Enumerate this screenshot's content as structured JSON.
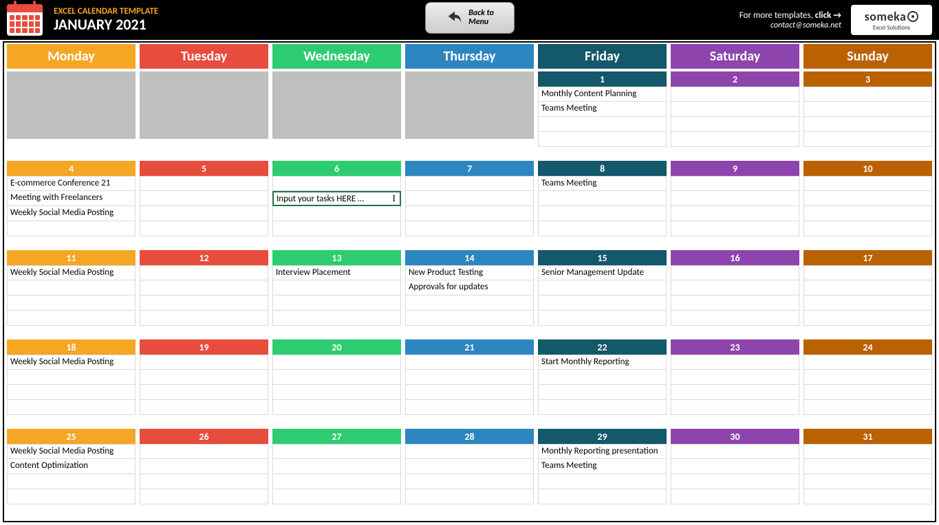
{
  "header": {
    "template_title": "EXCEL CALENDAR TEMPLATE",
    "month": "JANUARY 2021",
    "back_button": "Back to\nMenu",
    "more_templates_prefix": "For more templates, ",
    "more_templates_bold": "click →",
    "contact": "contact@someka.net",
    "logo_name": "someka",
    "logo_sub": "Excel Solutions"
  },
  "days": [
    "Monday",
    "Tuesday",
    "Wednesday",
    "Thursday",
    "Friday",
    "Saturday",
    "Sunday"
  ],
  "day_colors": [
    "#f5a623",
    "#e84c3d",
    "#2ecc71",
    "#2e86c1",
    "#13586b",
    "#8e44ad",
    "#ba6102"
  ],
  "editing_placeholder": "Input your tasks HERE …",
  "weeks": [
    [
      {
        "date": null,
        "tasks": []
      },
      {
        "date": null,
        "tasks": []
      },
      {
        "date": null,
        "tasks": []
      },
      {
        "date": null,
        "tasks": []
      },
      {
        "date": "1",
        "tasks": [
          "Monthly Content Planning",
          "Teams Meeting",
          "",
          ""
        ]
      },
      {
        "date": "2",
        "tasks": [
          "",
          "",
          "",
          ""
        ]
      },
      {
        "date": "3",
        "tasks": [
          "",
          "",
          "",
          ""
        ]
      }
    ],
    [
      {
        "date": "4",
        "tasks": [
          "E-commerce Conference 21",
          "Meeting with Freelancers",
          "Weekly Social Media Posting",
          ""
        ]
      },
      {
        "date": "5",
        "tasks": [
          "",
          "",
          "",
          ""
        ]
      },
      {
        "date": "6",
        "tasks": [
          "",
          "",
          "",
          ""
        ],
        "editing": true
      },
      {
        "date": "7",
        "tasks": [
          "",
          "",
          "",
          ""
        ]
      },
      {
        "date": "8",
        "tasks": [
          "Teams Meeting",
          "",
          "",
          ""
        ]
      },
      {
        "date": "9",
        "tasks": [
          "",
          "",
          "",
          ""
        ]
      },
      {
        "date": "10",
        "tasks": [
          "",
          "",
          "",
          ""
        ]
      }
    ],
    [
      {
        "date": "11",
        "tasks": [
          "Weekly Social Media Posting",
          "",
          "",
          ""
        ]
      },
      {
        "date": "12",
        "tasks": [
          "",
          "",
          "",
          ""
        ]
      },
      {
        "date": "13",
        "tasks": [
          "Interview Placement",
          "",
          "",
          ""
        ]
      },
      {
        "date": "14",
        "tasks": [
          "New Product Testing",
          "Approvals for updates",
          "",
          ""
        ]
      },
      {
        "date": "15",
        "tasks": [
          "Senior Management Update",
          "",
          "",
          ""
        ]
      },
      {
        "date": "16",
        "tasks": [
          "",
          "",
          "",
          ""
        ]
      },
      {
        "date": "17",
        "tasks": [
          "",
          "",
          "",
          ""
        ]
      }
    ],
    [
      {
        "date": "18",
        "tasks": [
          "Weekly Social Media Posting",
          "",
          "",
          ""
        ]
      },
      {
        "date": "19",
        "tasks": [
          "",
          "",
          "",
          ""
        ]
      },
      {
        "date": "20",
        "tasks": [
          "",
          "",
          "",
          ""
        ]
      },
      {
        "date": "21",
        "tasks": [
          "",
          "",
          "",
          ""
        ]
      },
      {
        "date": "22",
        "tasks": [
          "Start Monthly Reporting",
          "",
          "",
          ""
        ]
      },
      {
        "date": "23",
        "tasks": [
          "",
          "",
          "",
          ""
        ]
      },
      {
        "date": "24",
        "tasks": [
          "",
          "",
          "",
          ""
        ]
      }
    ],
    [
      {
        "date": "25",
        "tasks": [
          "Weekly Social Media Posting",
          "Content Optimization",
          "",
          ""
        ]
      },
      {
        "date": "26",
        "tasks": [
          "",
          "",
          "",
          ""
        ]
      },
      {
        "date": "27",
        "tasks": [
          "",
          "",
          "",
          ""
        ]
      },
      {
        "date": "28",
        "tasks": [
          "",
          "",
          "",
          ""
        ]
      },
      {
        "date": "29",
        "tasks": [
          "Monthly Reporting presentation",
          "Teams Meeting",
          "",
          ""
        ]
      },
      {
        "date": "30",
        "tasks": [
          "",
          "",
          "",
          ""
        ]
      },
      {
        "date": "31",
        "tasks": [
          "",
          "",
          "",
          ""
        ]
      }
    ]
  ]
}
